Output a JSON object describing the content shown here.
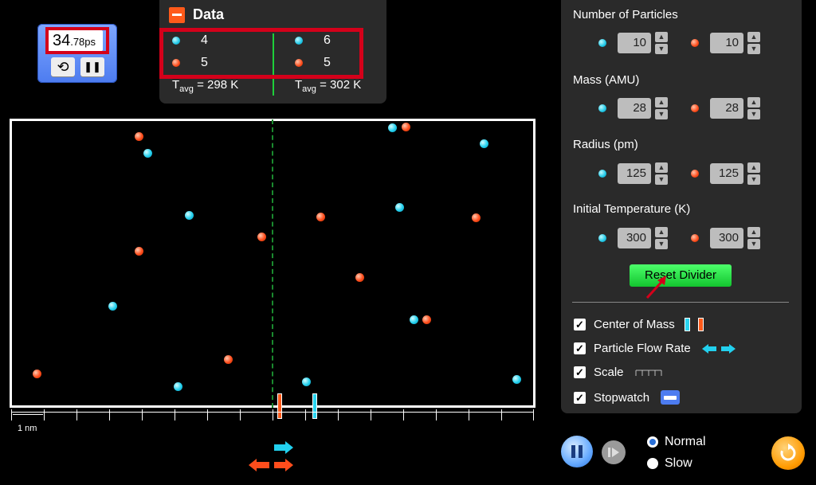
{
  "stopwatch": {
    "time_main": "34",
    "time_fraction": ".78",
    "unit": "ps",
    "reset_symbol": "⟲",
    "pause_symbol": "❚❚"
  },
  "data_panel": {
    "title": "Data",
    "left": {
      "blue_count": "4",
      "red_count": "5",
      "tavg_label": "T",
      "tavg_sub": "avg",
      "tavg_value": " = 298 K"
    },
    "right": {
      "blue_count": "6",
      "red_count": "5",
      "tavg_label": "T",
      "tavg_sub": "avg",
      "tavg_value": " = 302 K"
    }
  },
  "controls": {
    "num_particles": {
      "label": "Number of Particles",
      "blue": "10",
      "red": "10"
    },
    "mass": {
      "label": "Mass (AMU)",
      "blue": "28",
      "red": "28"
    },
    "radius": {
      "label": "Radius (pm)",
      "blue": "125",
      "red": "125"
    },
    "temperature": {
      "label": "Initial Temperature (K)",
      "blue": "300",
      "red": "300"
    },
    "reset_divider": "Reset Divider",
    "checkboxes": {
      "center_of_mass": "Center of Mass",
      "particle_flow_rate": "Particle Flow Rate",
      "scale": "Scale",
      "stopwatch": "Stopwatch"
    }
  },
  "scale_label": "1 nm",
  "speed": {
    "normal": "Normal",
    "slow": "Slow",
    "selected": "Normal"
  },
  "colors": {
    "blue_species": "#22d0ee",
    "red_species": "#ff4d1c",
    "panel": "#2a2a2a",
    "highlight": "#d4001a"
  }
}
